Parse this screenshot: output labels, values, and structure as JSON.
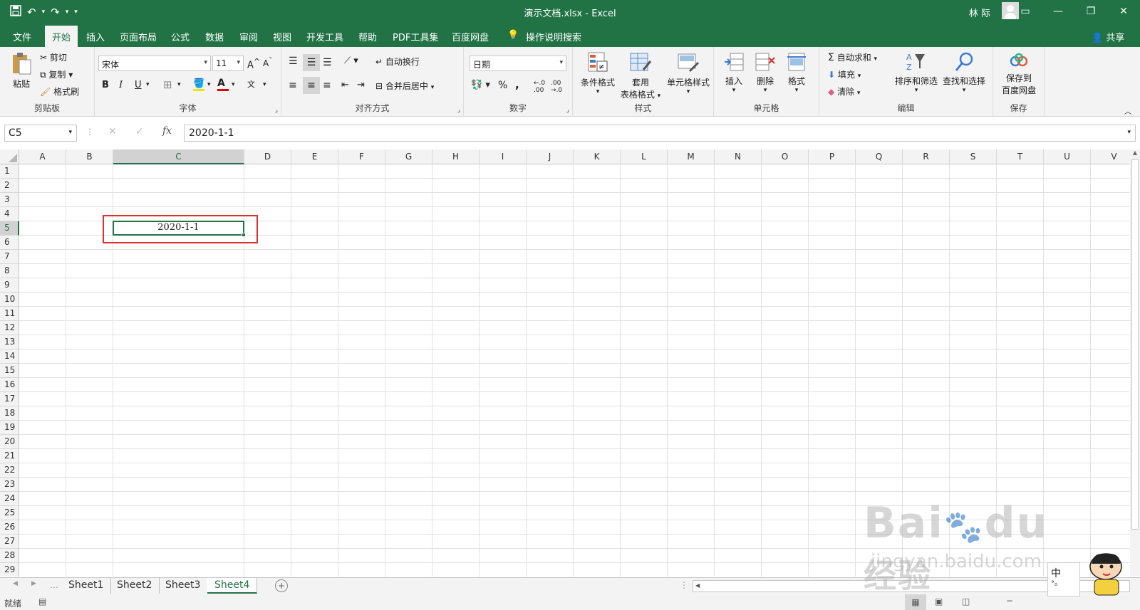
{
  "window": {
    "title": "演示文档.xlsx  -  Excel",
    "user": "林 际"
  },
  "qat": {
    "save": "💾",
    "undo": "↶",
    "redo": "↷"
  },
  "menu": [
    {
      "label": "文件"
    },
    {
      "label": "开始"
    },
    {
      "label": "插入"
    },
    {
      "label": "页面布局"
    },
    {
      "label": "公式"
    },
    {
      "label": "数据"
    },
    {
      "label": "审阅"
    },
    {
      "label": "视图"
    },
    {
      "label": "开发工具"
    },
    {
      "label": "帮助"
    },
    {
      "label": "PDF工具集"
    },
    {
      "label": "百度网盘"
    },
    {
      "label": "操作说明搜索"
    }
  ],
  "share": "共享",
  "ribbon": {
    "clipboard": {
      "label": "剪贴板",
      "paste": "粘贴",
      "cut": "剪切",
      "copy": "复制",
      "painter": "格式刷"
    },
    "font": {
      "label": "字体",
      "name": "宋体",
      "size": "11",
      "bold": "B",
      "italic": "I",
      "underline": "U"
    },
    "align": {
      "label": "对齐方式",
      "wrap": "自动换行",
      "merge": "合并后居中"
    },
    "number": {
      "label": "数字",
      "format": "日期",
      "percent": "%",
      "comma": ","
    },
    "styles": {
      "label": "样式",
      "cond": "条件格式",
      "table1": "套用",
      "table2": "表格格式",
      "cell": "单元格样式"
    },
    "cells": {
      "label": "单元格",
      "insert": "插入",
      "delete": "删除",
      "format": "格式"
    },
    "edit": {
      "label": "编辑",
      "sum": "自动求和",
      "fill": "填充",
      "clear": "清除",
      "sort": "排序和筛选",
      "find": "查找和选择"
    },
    "save": {
      "label": "保存",
      "btn1": "保存到",
      "btn2": "百度网盘"
    }
  },
  "formula_bar": {
    "name_box": "C5",
    "fx": "fx",
    "value": "2020-1-1"
  },
  "columns": [
    "A",
    "B",
    "C",
    "D",
    "E",
    "F",
    "G",
    "H",
    "I",
    "J",
    "K",
    "L",
    "M",
    "N",
    "O",
    "P",
    "Q",
    "R",
    "S",
    "T",
    "U",
    "V"
  ],
  "rows": [
    "1",
    "2",
    "3",
    "4",
    "5",
    "6",
    "7",
    "8",
    "9",
    "10",
    "11",
    "12",
    "13",
    "14",
    "15",
    "16",
    "17",
    "18",
    "19",
    "20",
    "21",
    "22",
    "23",
    "24",
    "25",
    "26",
    "27",
    "28",
    "29"
  ],
  "active_cell": {
    "ref": "C5",
    "value": "2020-1-1"
  },
  "sheets": [
    {
      "name": "Sheet1"
    },
    {
      "name": "Sheet2"
    },
    {
      "name": "Sheet3"
    },
    {
      "name": "Sheet4"
    }
  ],
  "active_sheet": "Sheet4",
  "status": {
    "ready": "就绪"
  },
  "watermark": {
    "brand": "Bai",
    "brand2": "du",
    "brand3": "经验",
    "url": "jingyan.baidu.com"
  },
  "ime": {
    "lang": "中"
  },
  "colors": {
    "excel_green": "#217346",
    "highlight_red": "#d9312f"
  }
}
